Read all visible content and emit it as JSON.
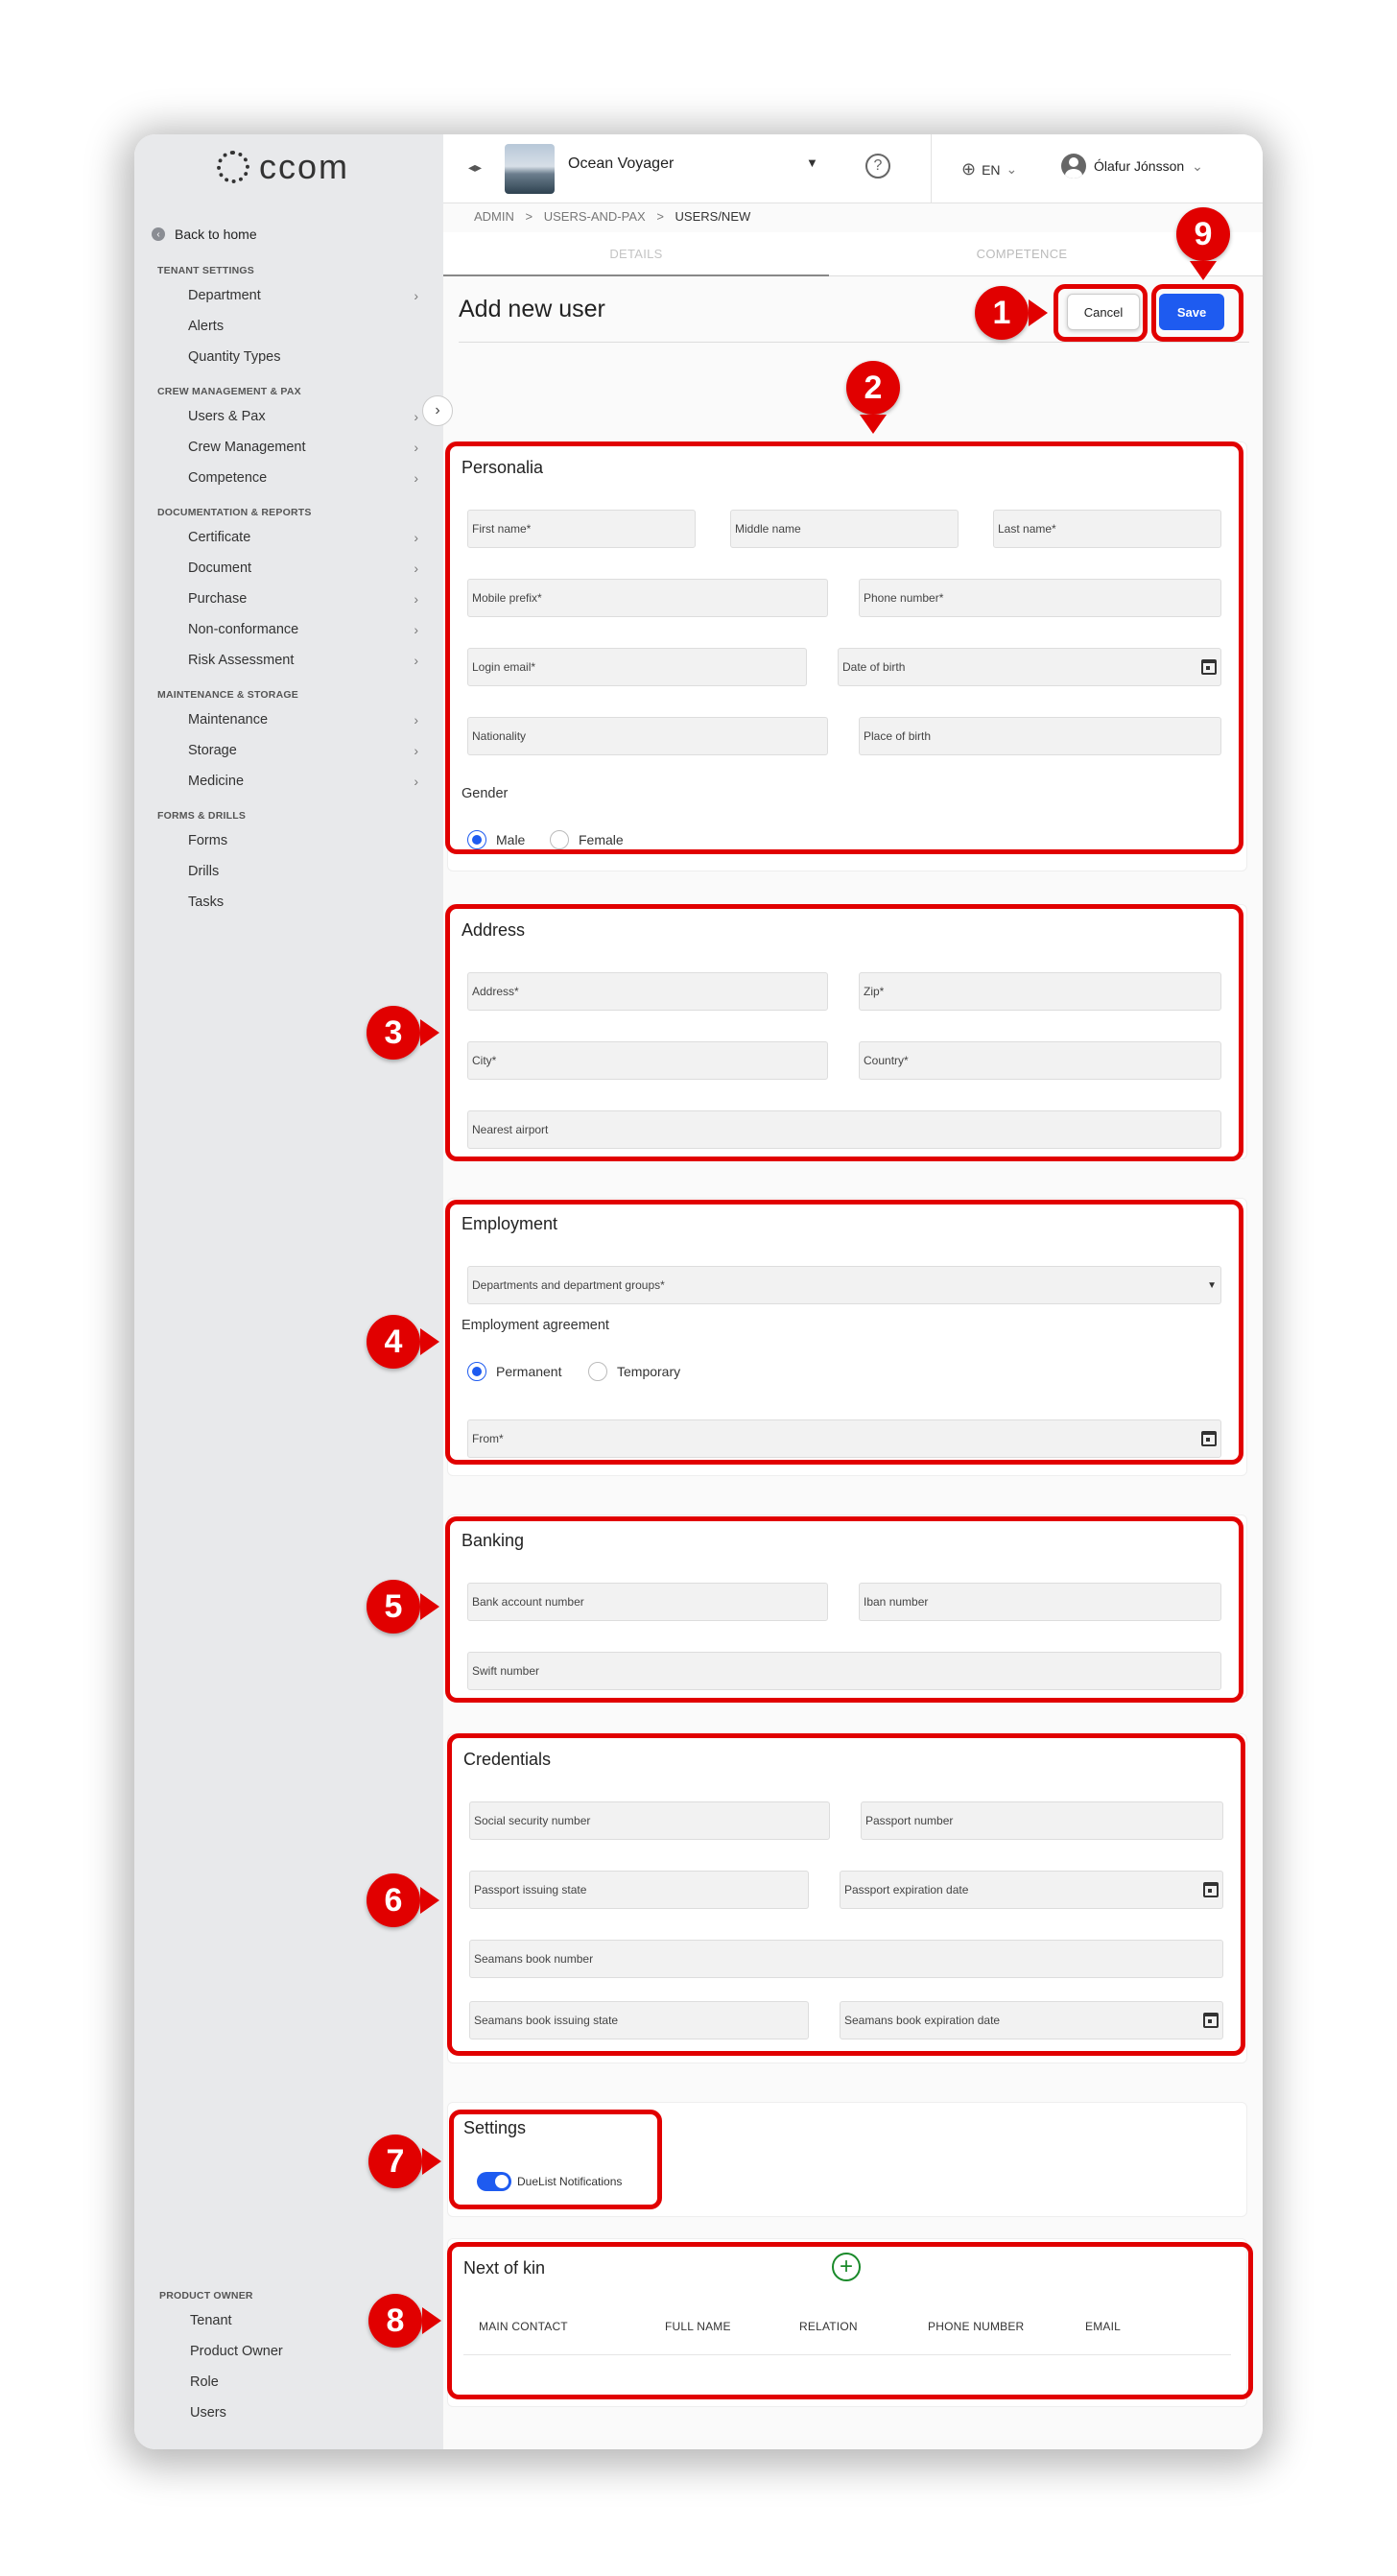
{
  "app": {
    "logo_text": "ccom",
    "back_label": "Back to home",
    "vessel_name": "Ocean Voyager",
    "help_glyph": "?",
    "language": "EN",
    "user_name": "Ólafur Jónsson",
    "collapse_glyph": "◂▸"
  },
  "breadcrumb": {
    "admin": "ADMIN",
    "users_and_pax": "USERS-AND-PAX",
    "current": "USERS/NEW",
    "sep": ">"
  },
  "tabs": {
    "details": "DETAILS",
    "competence": "COMPETENCE"
  },
  "sidebar": {
    "sections": [
      {
        "head": "TENANT SETTINGS",
        "items": [
          {
            "label": "Department",
            "chev": true
          },
          {
            "label": "Alerts",
            "chev": false
          },
          {
            "label": "Quantity Types",
            "chev": false
          }
        ]
      },
      {
        "head": "CREW MANAGEMENT & PAX",
        "items": [
          {
            "label": "Users & Pax",
            "chev": true
          },
          {
            "label": "Crew Management",
            "chev": true
          },
          {
            "label": "Competence",
            "chev": true
          }
        ]
      },
      {
        "head": "DOCUMENTATION & REPORTS",
        "items": [
          {
            "label": "Certificate",
            "chev": true
          },
          {
            "label": "Document",
            "chev": true
          },
          {
            "label": "Purchase",
            "chev": true
          },
          {
            "label": "Non-conformance",
            "chev": true
          },
          {
            "label": "Risk Assessment",
            "chev": true
          }
        ]
      },
      {
        "head": "MAINTENANCE & STORAGE",
        "items": [
          {
            "label": "Maintenance",
            "chev": true
          },
          {
            "label": "Storage",
            "chev": true
          },
          {
            "label": "Medicine",
            "chev": true
          }
        ]
      },
      {
        "head": "FORMS & DRILLS",
        "items": [
          {
            "label": "Forms",
            "chev": false
          },
          {
            "label": "Drills",
            "chev": false
          },
          {
            "label": "Tasks",
            "chev": false
          }
        ]
      }
    ],
    "product_owner": {
      "head": "PRODUCT OWNER",
      "items": [
        "Tenant",
        "Product Owner",
        "Role",
        "Users"
      ]
    }
  },
  "page": {
    "title": "Add new user",
    "cancel_label": "Cancel",
    "save_label": "Save"
  },
  "personalia": {
    "title": "Personalia",
    "first_name": "First name*",
    "middle_name": "Middle name",
    "last_name": "Last name*",
    "mobile_prefix": "Mobile prefix*",
    "phone_number": "Phone number*",
    "login_email": "Login email*",
    "date_of_birth": "Date of birth",
    "nationality": "Nationality",
    "place_of_birth": "Place of birth",
    "gender_label": "Gender",
    "gender_male": "Male",
    "gender_female": "Female",
    "gender_selected": "Male"
  },
  "address": {
    "title": "Address",
    "address": "Address*",
    "zip": "Zip*",
    "city": "City*",
    "country": "Country*",
    "nearest_airport": "Nearest airport"
  },
  "employment": {
    "title": "Employment",
    "departments": "Departments and department groups*",
    "agreement_label": "Employment agreement",
    "permanent": "Permanent",
    "temporary": "Temporary",
    "agreement_selected": "Permanent",
    "from": "From*"
  },
  "banking": {
    "title": "Banking",
    "bank_account": "Bank account number",
    "iban": "Iban number",
    "swift": "Swift number"
  },
  "credentials": {
    "title": "Credentials",
    "ssn": "Social security number",
    "passport_number": "Passport number",
    "passport_state": "Passport issuing state",
    "passport_expiration": "Passport expiration date",
    "seamans_book_number": "Seamans book number",
    "seamans_book_state": "Seamans book issuing state",
    "seamans_book_expiration": "Seamans book expiration date"
  },
  "settings": {
    "title": "Settings",
    "duelist_label": "DueList Notifications",
    "duelist_on": true
  },
  "next_of_kin": {
    "title": "Next of kin",
    "add_glyph": "+",
    "columns": [
      "MAIN CONTACT",
      "FULL NAME",
      "RELATION",
      "PHONE NUMBER",
      "EMAIL"
    ]
  },
  "annotations": [
    "1",
    "2",
    "3",
    "4",
    "5",
    "6",
    "7",
    "8",
    "9"
  ],
  "colors": {
    "accent": "#1e5bf0",
    "annotation": "#e10000",
    "sidebar_bg": "#e8e9eb",
    "add_green": "#1a8a2a"
  }
}
